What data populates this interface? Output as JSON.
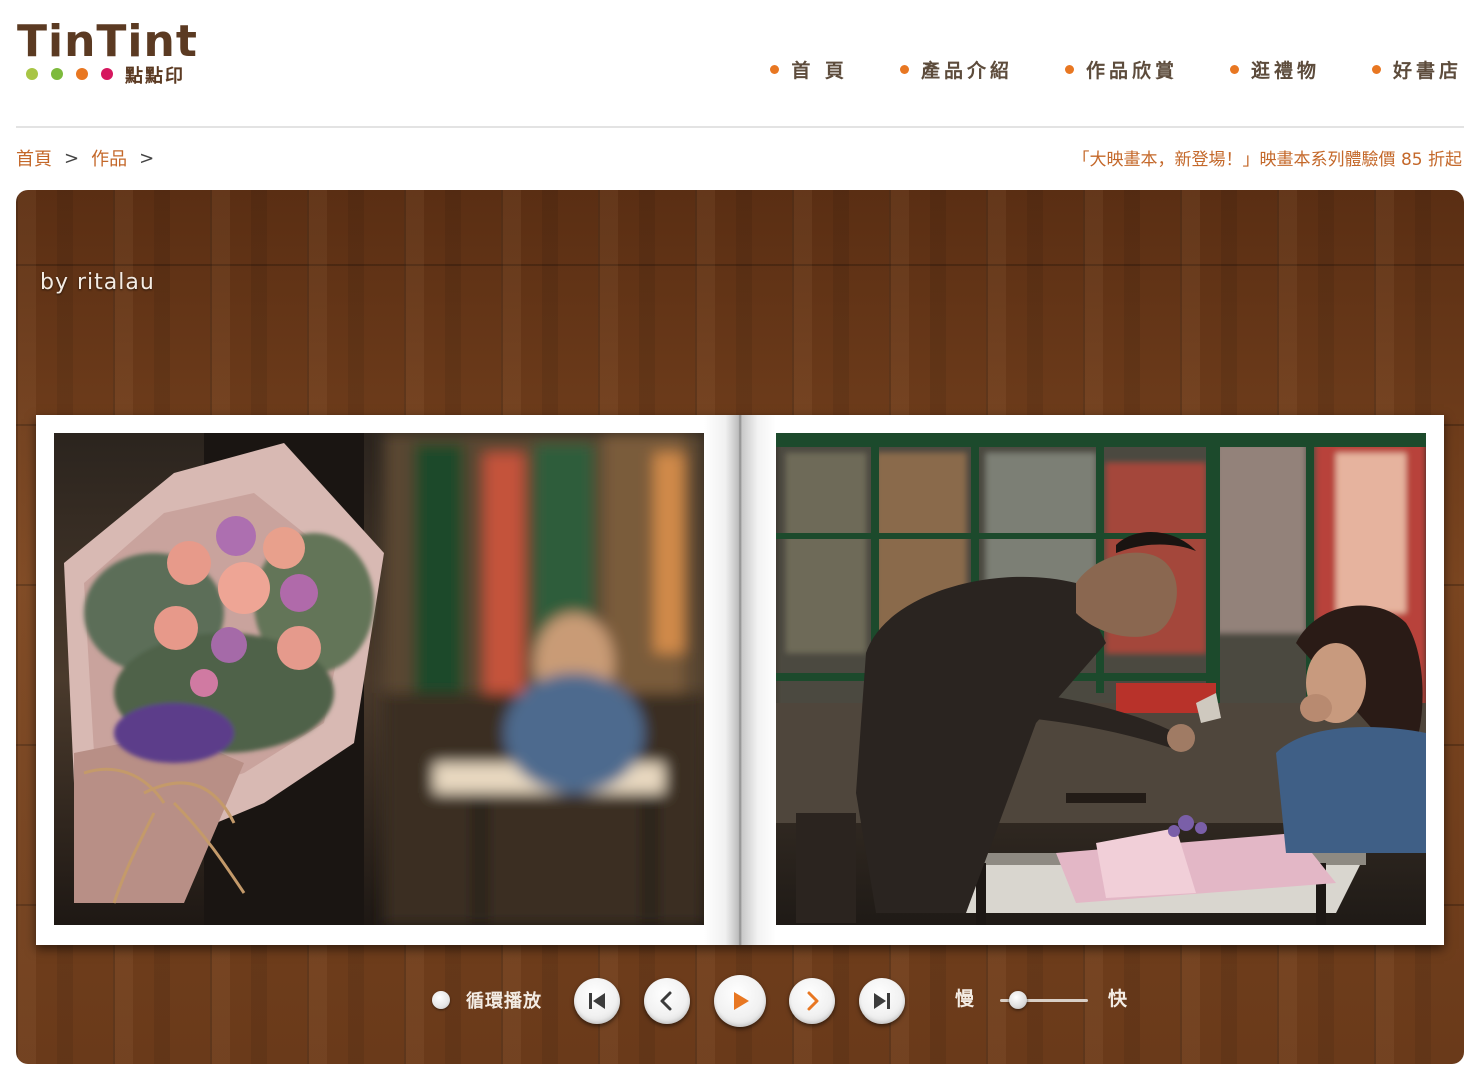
{
  "brand": {
    "name": "TinTint",
    "subtitle": "點點印",
    "dot_colors": [
      "#a8c545",
      "#7dba3c",
      "#e87722",
      "#d6175f"
    ]
  },
  "nav": {
    "items": [
      {
        "label": "首 頁"
      },
      {
        "label": "產品介紹"
      },
      {
        "label": "作品欣賞"
      },
      {
        "label": "逛禮物"
      },
      {
        "label": "好書店"
      }
    ]
  },
  "breadcrumb": {
    "home": "首頁",
    "works": "作品",
    "separator": ">"
  },
  "promo": "「大映畫本，新登場！」映畫本系列體驗價 85 折起",
  "viewer": {
    "title": "by ritalau"
  },
  "controls": {
    "loop_label": "循環播放",
    "slow_label": "慢",
    "fast_label": "快",
    "speed_level": 0.2,
    "icons": [
      "first-page-icon",
      "previous-icon",
      "play-icon",
      "next-icon",
      "last-page-icon"
    ]
  },
  "colors": {
    "accent": "#e87722",
    "link": "#c4682a",
    "brand_brown": "#5b3a22"
  }
}
